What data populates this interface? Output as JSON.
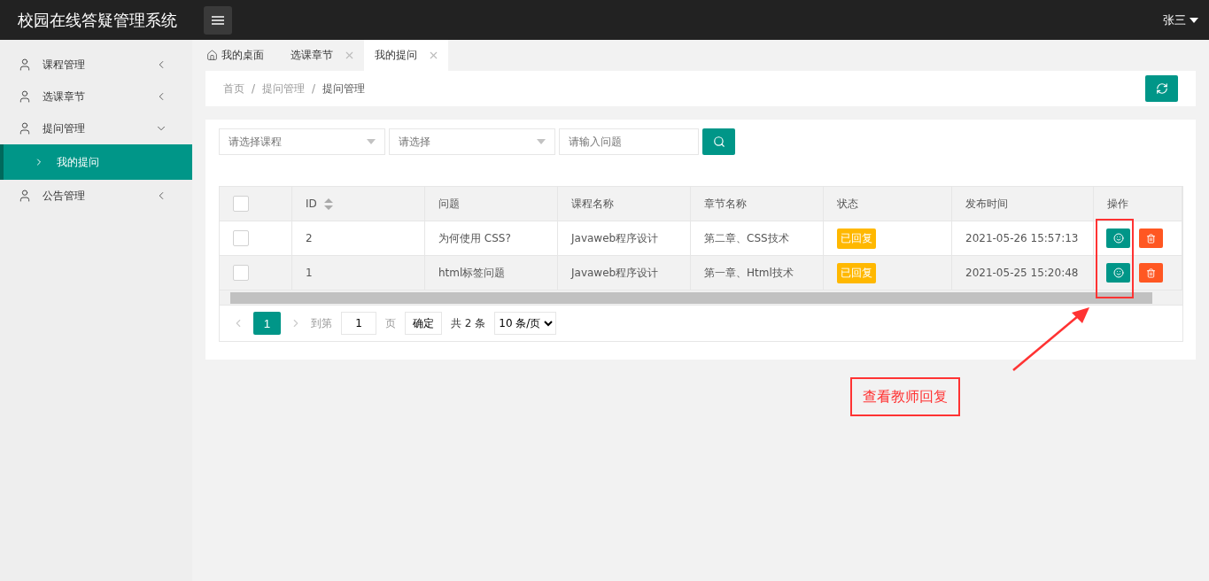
{
  "header": {
    "title": "校园在线答疑管理系统",
    "user": "张三"
  },
  "sidebar": {
    "items": [
      {
        "label": "课程管理",
        "expanded": false
      },
      {
        "label": "选课章节",
        "expanded": false
      },
      {
        "label": "提问管理",
        "expanded": true,
        "children": [
          {
            "label": "我的提问",
            "selected": true
          }
        ]
      },
      {
        "label": "公告管理",
        "expanded": false
      }
    ]
  },
  "tabs": [
    {
      "label": "我的桌面",
      "kind": "home",
      "selected": false
    },
    {
      "label": "选课章节",
      "kind": "closable",
      "selected": false
    },
    {
      "label": "我的提问",
      "kind": "closable",
      "selected": true
    }
  ],
  "breadcrumb": {
    "separator": "/",
    "items": [
      "首页",
      "提问管理",
      "提问管理"
    ]
  },
  "filters": {
    "course": {
      "placeholder": "请选择课程"
    },
    "chapter": {
      "placeholder": "请选择"
    },
    "question": {
      "placeholder": "请输入问题"
    }
  },
  "table": {
    "all_checked": false,
    "columns": [
      {
        "label": "ID",
        "sortable": true
      },
      {
        "label": "问题",
        "sortable": false
      },
      {
        "label": "课程名称",
        "sortable": false
      },
      {
        "label": "章节名称",
        "sortable": false
      },
      {
        "label": "状态",
        "sortable": false
      },
      {
        "label": "发布时间",
        "sortable": false
      },
      {
        "label": "操作",
        "sortable": false
      }
    ],
    "rows": [
      {
        "checked": false,
        "id": "2",
        "question": "为何使用 CSS?",
        "course": "Javaweb程序设计",
        "chapter": "第二章、CSS技术",
        "status": "已回复",
        "time": "2021-05-26 15:57:13"
      },
      {
        "checked": false,
        "id": "1",
        "question": "html标签问题",
        "course": "Javaweb程序设计",
        "chapter": "第一章、Html技术",
        "status": "已回复",
        "time": "2021-05-25 15:20:48"
      }
    ]
  },
  "pagination": {
    "pages": [
      {
        "label": "1",
        "selected": true
      }
    ],
    "goto_label": "到第",
    "goto_value": "1",
    "page_unit": "页",
    "confirm": "确定",
    "total": "共 2 条",
    "page_size": "10 条/页"
  },
  "annotation": {
    "text": "查看教师回复"
  }
}
